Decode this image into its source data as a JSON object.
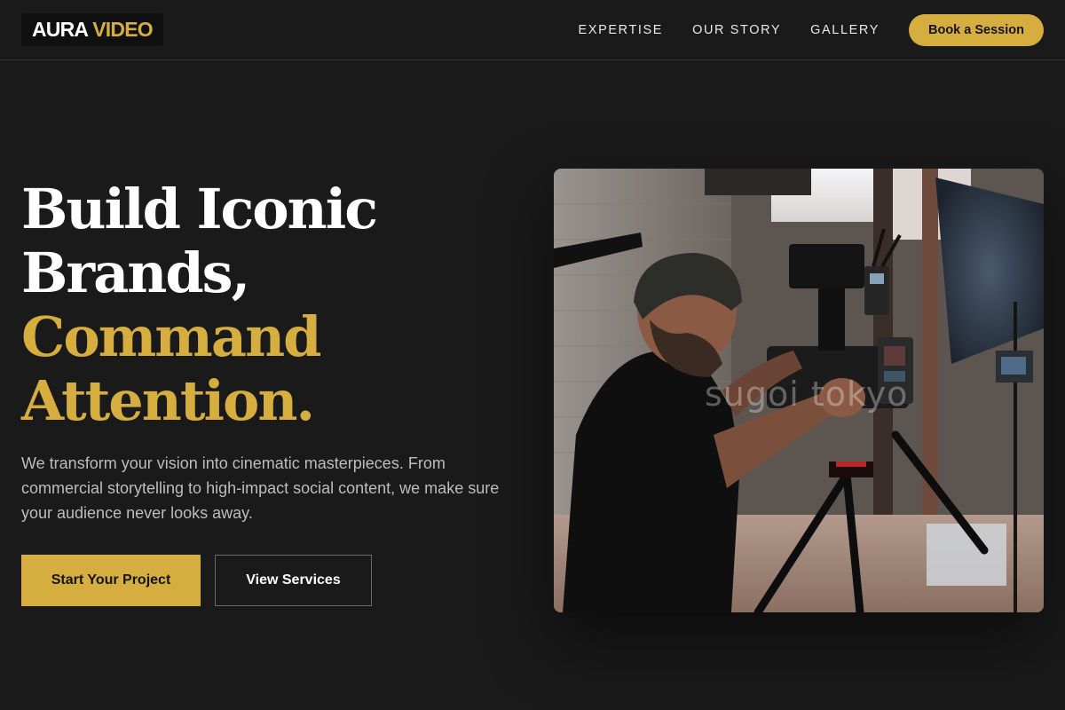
{
  "brand": {
    "part1": "AURA",
    "part2": "VIDEO"
  },
  "nav": {
    "links": [
      "EXPERTISE",
      "OUR STORY",
      "GALLERY"
    ],
    "cta": "Book a Session"
  },
  "hero": {
    "headline_line1": "Build Iconic",
    "headline_line2": "Brands,",
    "headline_line3": "Command",
    "headline_line4": "Attention.",
    "description": "We transform your vision into cinematic masterpieces. From commercial storytelling to high-impact social content, we make sure your audience never looks away.",
    "primary_button": "Start Your Project",
    "secondary_button": "View Services",
    "image_watermark": "sugoi tokyo"
  },
  "colors": {
    "background": "#1a1a1a",
    "accent": "#d6ad3f",
    "text": "#ffffff",
    "muted_text": "#bdbdbd"
  }
}
